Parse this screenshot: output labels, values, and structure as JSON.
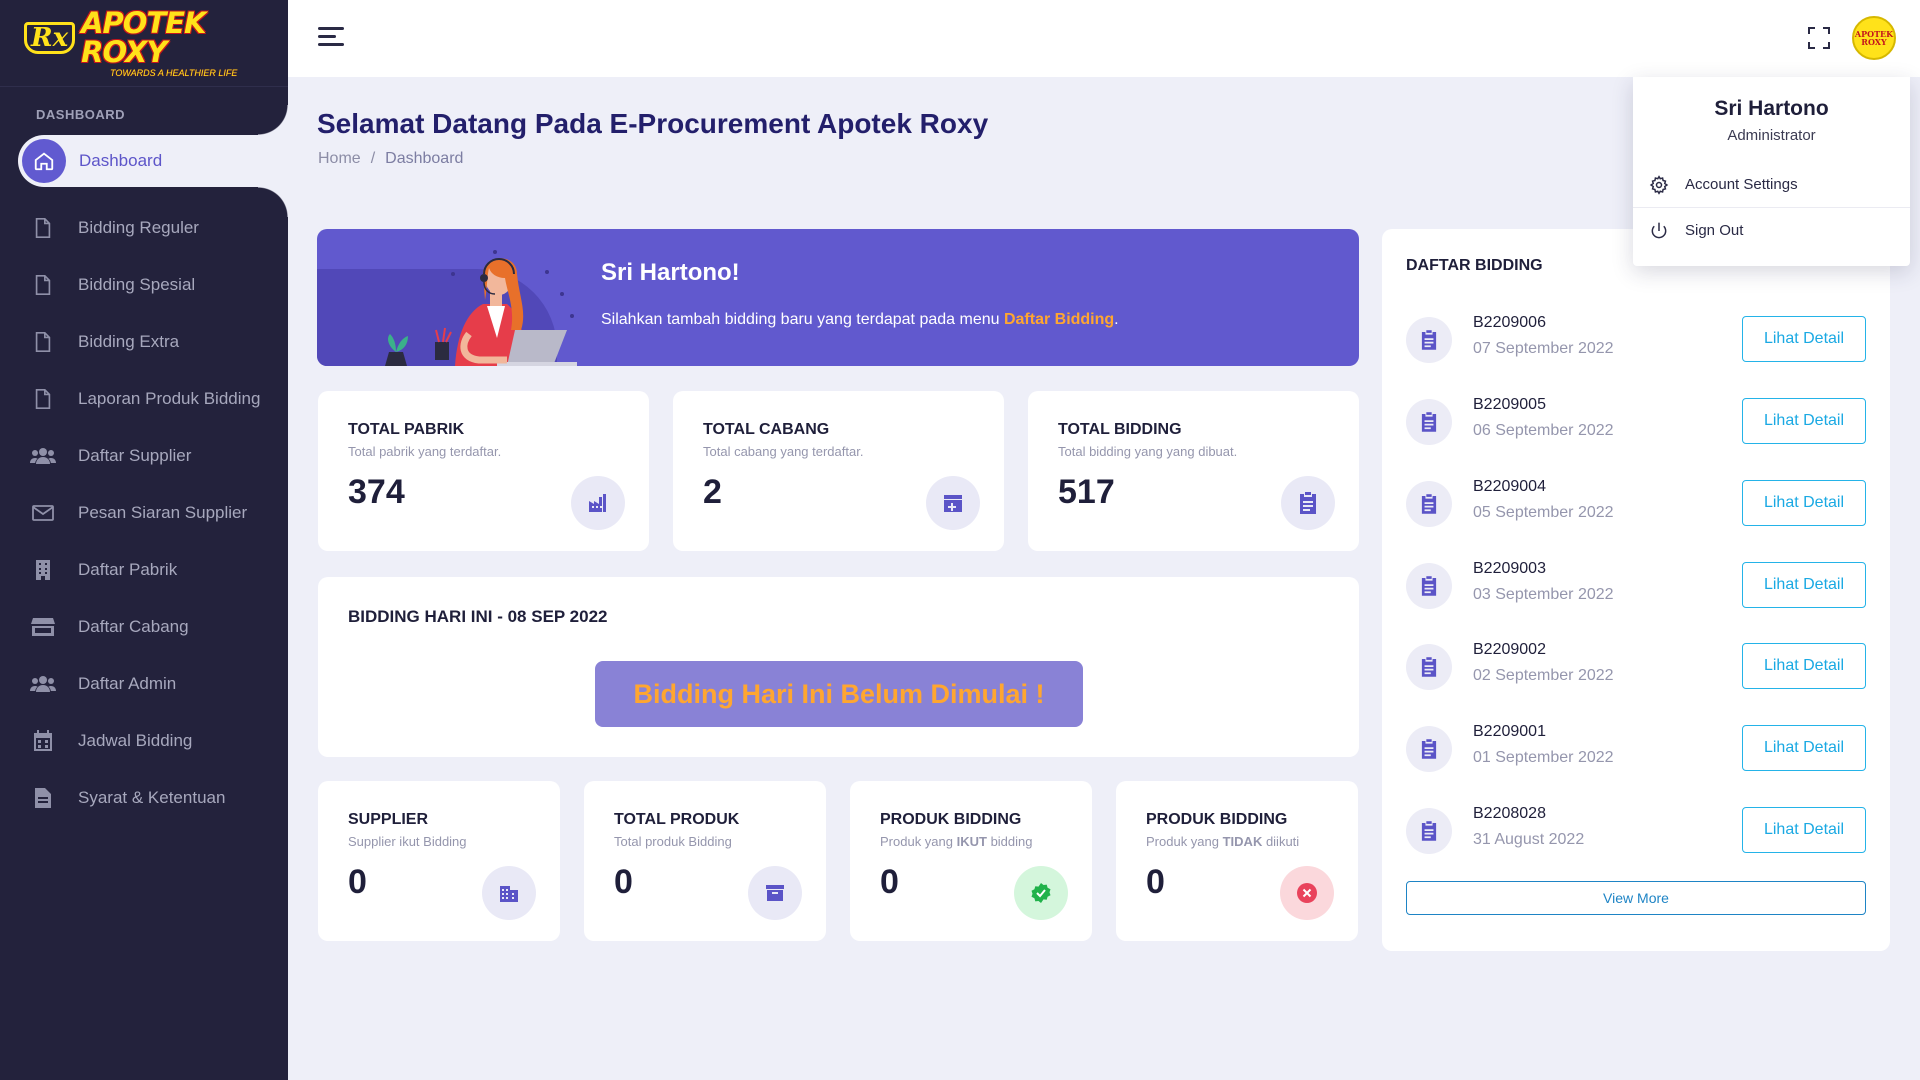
{
  "brand": {
    "name": "APOTEK ROXY",
    "mark": "Rx",
    "tagline": "TOWARDS A HEALTHIER LIFE"
  },
  "sidebar": {
    "section": "DASHBOARD",
    "items": [
      {
        "label": "Dashboard",
        "icon": "home-icon",
        "active": true
      },
      {
        "label": "Bidding Reguler",
        "icon": "file-icon"
      },
      {
        "label": "Bidding Spesial",
        "icon": "file-icon"
      },
      {
        "label": "Bidding Extra",
        "icon": "file-icon"
      },
      {
        "label": "Laporan Produk Bidding",
        "icon": "file-icon"
      },
      {
        "label": "Daftar Supplier",
        "icon": "users-icon"
      },
      {
        "label": "Pesan Siaran Supplier",
        "icon": "mail-icon"
      },
      {
        "label": "Daftar Pabrik",
        "icon": "building-icon"
      },
      {
        "label": "Daftar Cabang",
        "icon": "store-icon"
      },
      {
        "label": "Daftar Admin",
        "icon": "users-icon"
      },
      {
        "label": "Jadwal Bidding",
        "icon": "calendar-icon"
      },
      {
        "label": "Syarat & Ketentuan",
        "icon": "document-icon"
      }
    ]
  },
  "topbar": {
    "avatar_text": "APOTEK ROXY"
  },
  "user_menu": {
    "name": "Sri Hartono",
    "role": "Administrator",
    "items": [
      {
        "label": "Account Settings",
        "icon": "gear-icon"
      },
      {
        "label": "Sign Out",
        "icon": "power-icon"
      }
    ]
  },
  "page": {
    "title": "Selamat Datang Pada E-Procurement Apotek Roxy",
    "breadcrumb": [
      "Home",
      "/",
      "Dashboard"
    ]
  },
  "welcome": {
    "title": "Sri Hartono!",
    "text": "Silahkan tambah bidding baru yang terdapat pada menu ",
    "link": "Daftar Bidding",
    "suffix": "."
  },
  "stats_top": [
    {
      "title": "TOTAL PABRIK",
      "subtitle": "Total pabrik yang terdaftar.",
      "value": "374",
      "icon": "factory-icon"
    },
    {
      "title": "TOTAL CABANG",
      "subtitle": "Total cabang yang terdaftar.",
      "value": "2",
      "icon": "branch-icon"
    },
    {
      "title": "TOTAL BIDDING",
      "subtitle": "Total bidding yang yang dibuat.",
      "value": "517",
      "icon": "clipboard-icon"
    }
  ],
  "today": {
    "title": "BIDDING HARI INI - 08 SEP 2022",
    "status": "Bidding Hari Ini Belum Dimulai !"
  },
  "stats_bottom": [
    {
      "title": "SUPPLIER",
      "subtitle_pre": "Supplier ikut Bidding",
      "subtitle_bold": "",
      "subtitle_post": "",
      "value": "0",
      "icon": "building-icon",
      "tone": "default"
    },
    {
      "title": "TOTAL PRODUK",
      "subtitle_pre": "Total produk Bidding",
      "subtitle_bold": "",
      "subtitle_post": "",
      "value": "0",
      "icon": "archive-icon",
      "tone": "default"
    },
    {
      "title": "PRODUK BIDDING",
      "subtitle_pre": "Produk yang ",
      "subtitle_bold": "IKUT",
      "subtitle_post": " bidding",
      "value": "0",
      "icon": "check-badge-icon",
      "tone": "green"
    },
    {
      "title": "PRODUK BIDDING",
      "subtitle_pre": "Produk yang ",
      "subtitle_bold": "TIDAK",
      "subtitle_post": " diikuti",
      "value": "0",
      "icon": "x-circle-icon",
      "tone": "red"
    }
  ],
  "bidding_list": {
    "title": "DAFTAR BIDDING",
    "button_label": "Lihat Detail",
    "view_more": "View More",
    "rows": [
      {
        "code": "B2209006",
        "date": "07 September 2022"
      },
      {
        "code": "B2209005",
        "date": "06 September 2022"
      },
      {
        "code": "B2209004",
        "date": "05 September 2022"
      },
      {
        "code": "B2209003",
        "date": "03 September 2022"
      },
      {
        "code": "B2209002",
        "date": "02 September 2022"
      },
      {
        "code": "B2209001",
        "date": "01 September 2022"
      },
      {
        "code": "B2208028",
        "date": "31 August 2022"
      }
    ]
  },
  "colors": {
    "sidebar": "#23223c",
    "primary": "#6159ce",
    "accent_orange": "#ffa630",
    "link_blue": "#1aa9e3",
    "background": "#eeeff8"
  }
}
